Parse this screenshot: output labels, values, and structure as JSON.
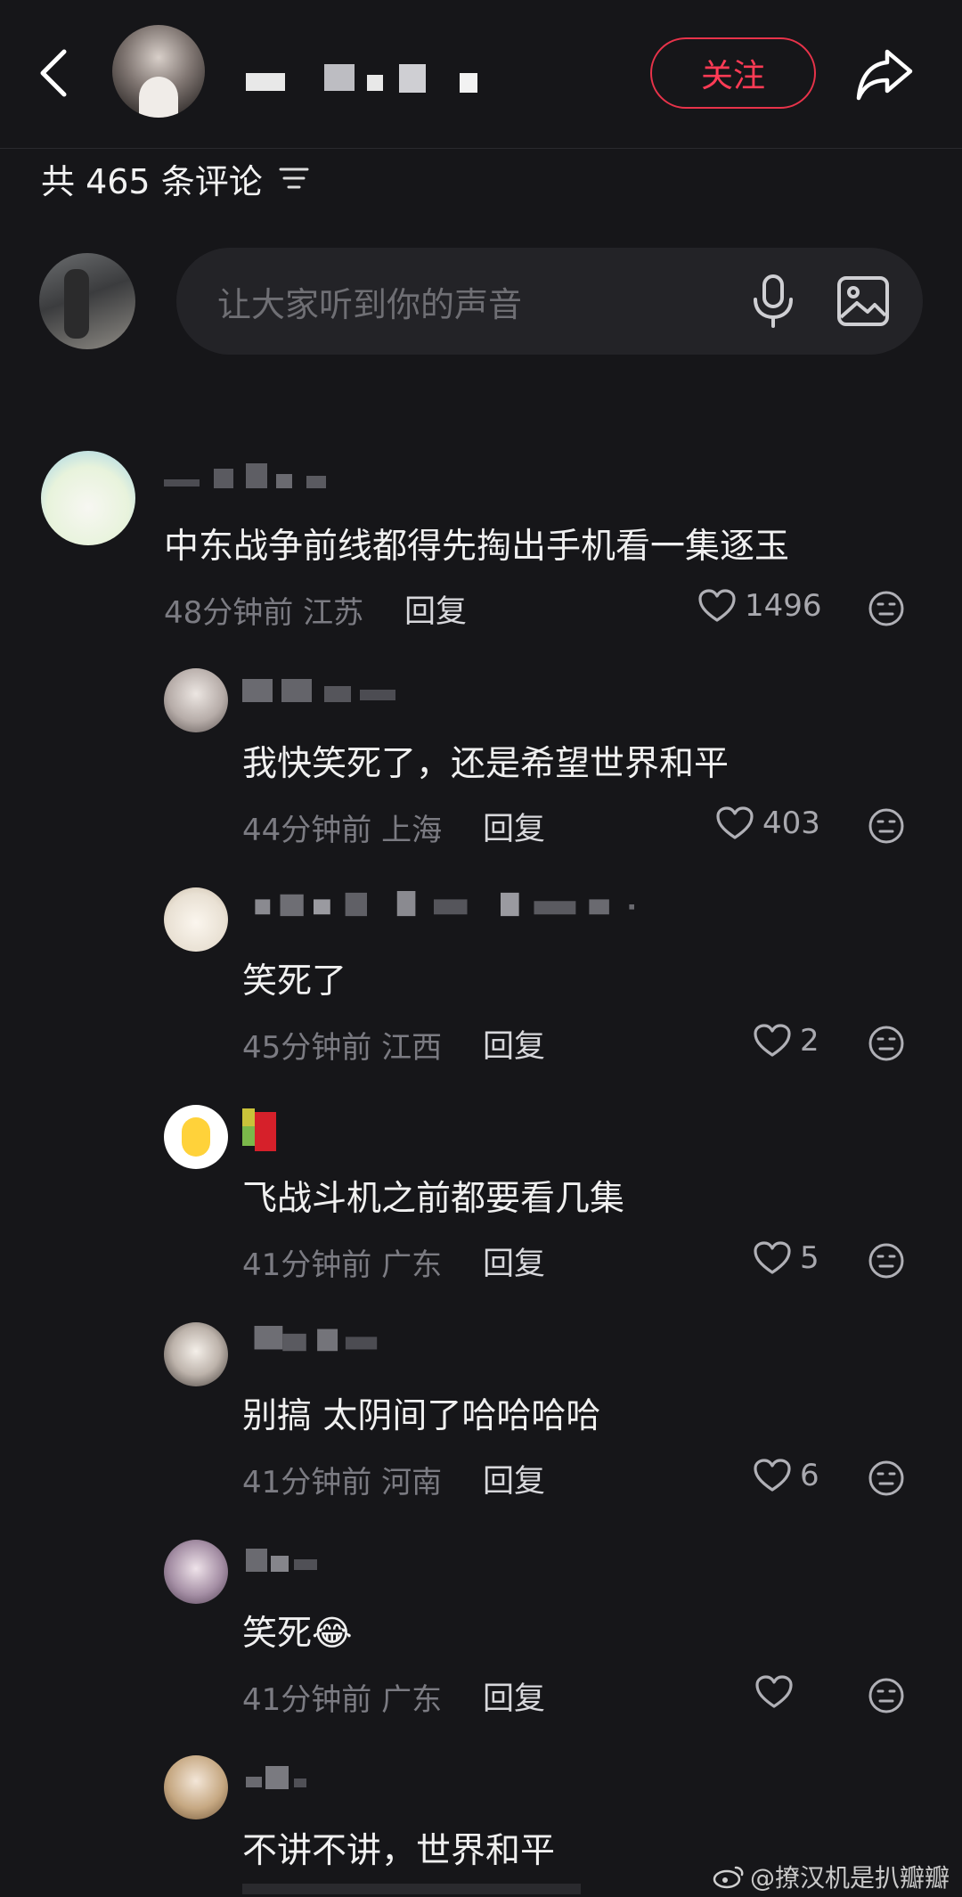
{
  "header": {
    "follow_label": "关注"
  },
  "comments_header": {
    "count_text": "共 465 条评论"
  },
  "composer": {
    "placeholder": "让大家听到你的声音"
  },
  "comments": [
    {
      "text": "中东战争前线都得先掏出手机看一集逐玉",
      "time": "48分钟前",
      "location": "江苏",
      "reply": "回复",
      "likes": "1496"
    },
    {
      "text": "我快笑死了，还是希望世界和平",
      "time": "44分钟前",
      "location": "上海",
      "reply": "回复",
      "likes": "403"
    },
    {
      "text": "笑死了",
      "time": "45分钟前",
      "location": "江西",
      "reply": "回复",
      "likes": "2"
    },
    {
      "text": "飞战斗机之前都要看几集",
      "time": "41分钟前",
      "location": "广东",
      "reply": "回复",
      "likes": "5"
    },
    {
      "text": "别搞 太阴间了哈哈哈哈",
      "time": "41分钟前",
      "location": "河南",
      "reply": "回复",
      "likes": "6"
    },
    {
      "text": "笑死😂",
      "time": "41分钟前",
      "location": "广东",
      "reply": "回复",
      "likes": ""
    },
    {
      "text": "不讲不讲，世界和平"
    }
  ],
  "watermark": {
    "text": "@撩汉机是扒瓣瓣"
  },
  "colors": {
    "background": "#161619",
    "accent": "#ff3b55",
    "input_bg": "#232327"
  }
}
